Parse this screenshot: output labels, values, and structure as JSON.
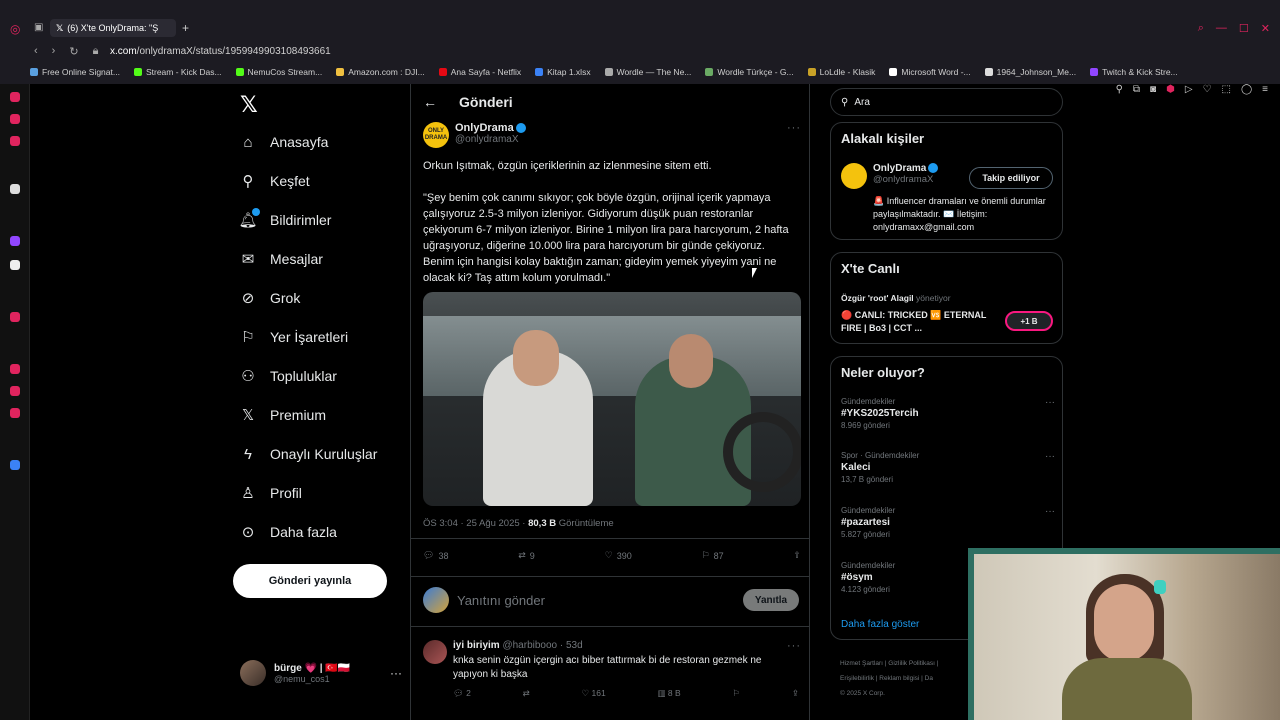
{
  "browser": {
    "tab_title": "(6) X'te OnlyDrama: \"Ş",
    "url_host": "x.com",
    "url_path": "/onlydramaX/status/1959949903108493661",
    "bookmarks": [
      {
        "label": "Free Online Signat...",
        "color": "#5aa0e0"
      },
      {
        "label": "Stream - Kick Das...",
        "color": "#53fc18"
      },
      {
        "label": "NemuCos Stream...",
        "color": "#53fc18"
      },
      {
        "label": "Amazon.com : DJI...",
        "color": "#f0c040"
      },
      {
        "label": "Ana Sayfa - Netflix",
        "color": "#e50914"
      },
      {
        "label": "Kitap 1.xlsx",
        "color": "#3b82f6"
      },
      {
        "label": "Wordle — The Ne...",
        "color": "#aaaaaa"
      },
      {
        "label": "Wordle Türkçe - G...",
        "color": "#6aaa64"
      },
      {
        "label": "LoLdle - Klasik",
        "color": "#c9a227"
      },
      {
        "label": "Microsoft Word -...",
        "color": "#ffffff"
      },
      {
        "label": "1964_Johnson_Me...",
        "color": "#dddddd"
      },
      {
        "label": "Twitch & Kick Stre...",
        "color": "#9146ff"
      }
    ]
  },
  "nav": {
    "home": "Anasayfa",
    "explore": "Keşfet",
    "notifications": "Bildirimler",
    "messages": "Mesajlar",
    "grok": "Grok",
    "bookmarks": "Yer İşaretleri",
    "communities": "Topluluklar",
    "premium": "Premium",
    "verified_orgs": "Onaylı Kuruluşlar",
    "profile": "Profil",
    "more": "Daha fazla",
    "post_button": "Gönderi yayınla"
  },
  "account": {
    "name": "bürge 💗 | 🇹🇷🇵🇱",
    "handle": "@nemu_cos1"
  },
  "main": {
    "title": "Gönderi",
    "author_name": "OnlyDrama",
    "author_handle": "@onlydramaX",
    "avatar_text": "ONLY DRAMA",
    "text_intro": "Orkun Işıtmak, özgün içeriklerinin az izlenmesine sitem etti.",
    "text_quote": "\"Şey benim çok canımı sıkıyor; çok böyle özgün, orijinal içerik yapmaya çalışıyoruz 2.5-3 milyon izleniyor. Gidiyorum düşük puan restoranlar çekiyorum 6-7 milyon izleniyor. Birine 1 milyon lira para harcıyorum, 2 hafta uğraşıyoruz, diğerine 10.000 lira para harcıyorum bir günde çekiyoruz. Benim için hangisi kolay baktığın zaman; gideyim yemek yiyeyim yani ne olacak ki? Taş attım kolum yorulmadı.\"",
    "time": "ÖS 3:04 · 25 Ağu 2025 ·",
    "views": "80,3 B",
    "views_label": "Görüntüleme",
    "replies": "38",
    "reposts": "9",
    "likes": "390",
    "bookmarks": "87",
    "reply_placeholder": "Yanıtını gönder",
    "reply_button": "Yanıtla"
  },
  "reply": {
    "name": "iyi biriyim",
    "handle": "@harbibooo · 53d",
    "text": "knka senin özgün içergin acı biber tattırmak bi de restoran gezmek ne yapıyon ki başka",
    "replies": "2",
    "likes": "161",
    "views": "8 B"
  },
  "right": {
    "search_placeholder": "Ara",
    "related_title": "Alakalı kişiler",
    "rel_name": "OnlyDrama",
    "rel_handle": "@onlydramaX",
    "follow_button": "Takip ediliyor",
    "rel_bio": "🚨 Influencer dramaları ve önemli durumlar paylaşılmaktadır. ✉️ İletişim: onlydramaxx@gmail.com",
    "live_title": "X'te Canlı",
    "live_host": "Özgür 'root' Alagil",
    "live_host_suffix": "yönetiyor",
    "live_desc": "🔴 CANLI: TRICKED 🆚 ETERNAL FIRE | Bo3 | CCT ...",
    "live_count": "+1 B",
    "trends_title": "Neler oluyor?",
    "trends": [
      {
        "cat": "Gündemdekiler",
        "tag": "#YKS2025Tercih",
        "count": "8.969 gönderi"
      },
      {
        "cat": "Spor · Gündemdekiler",
        "tag": "Kaleci",
        "count": "13,7 B gönderi"
      },
      {
        "cat": "Gündemdekiler",
        "tag": "#pazartesi",
        "count": "5.827 gönderi"
      },
      {
        "cat": "Gündemdekiler",
        "tag": "#ösym",
        "count": "4.123 gönderi"
      }
    ],
    "show_more": "Daha fazla göster",
    "footer_1": "Hizmet Şartları  |  Gizlilik Politikası  |",
    "footer_2": "Erişilebilirlik  |  Reklam bilgisi  |  Da",
    "footer_3": "© 2025 X Corp."
  }
}
